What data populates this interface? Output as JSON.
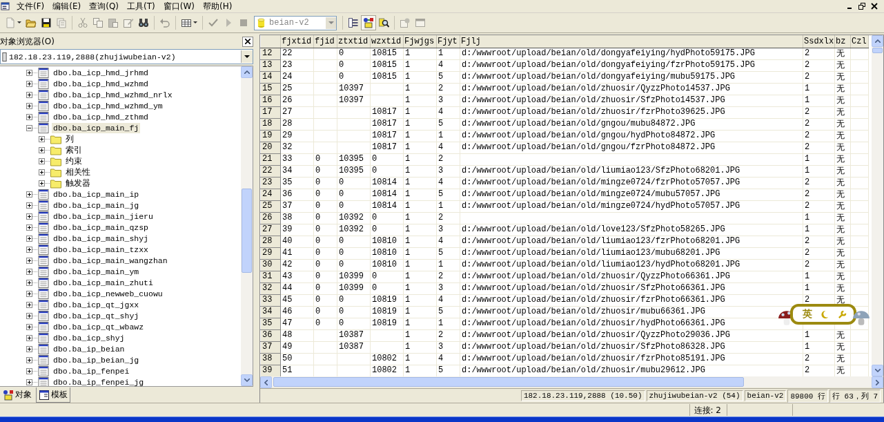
{
  "menu": [
    "文件(F)",
    "编辑(E)",
    "查询(Q)",
    "工具(T)",
    "窗口(W)",
    "帮助(H)"
  ],
  "toolbar_left": [
    [
      {
        "kind": "new",
        "disabled": true,
        "pressed": false
      },
      {
        "kind": "open",
        "disabled": false,
        "pressed": false
      },
      {
        "kind": "save",
        "disabled": false,
        "pressed": false
      },
      {
        "kind": "template",
        "disabled": true,
        "pressed": false
      }
    ],
    [
      {
        "kind": "cut",
        "disabled": true,
        "pressed": false
      },
      {
        "kind": "copy",
        "disabled": true,
        "pressed": false
      },
      {
        "kind": "paste",
        "disabled": true,
        "pressed": false
      },
      {
        "kind": "edit",
        "disabled": true,
        "pressed": false
      },
      {
        "kind": "find",
        "disabled": false,
        "pressed": false
      }
    ],
    [
      {
        "kind": "undo",
        "disabled": true,
        "pressed": false
      }
    ],
    [
      {
        "kind": "grid",
        "disabled": false,
        "pressed": false
      }
    ],
    [
      {
        "kind": "check",
        "disabled": true,
        "pressed": false
      },
      {
        "kind": "run",
        "disabled": true,
        "pressed": false
      },
      {
        "kind": "stop",
        "disabled": true,
        "pressed": false
      }
    ]
  ],
  "database_combo": {
    "value": "beian-v2"
  },
  "toolbar_right": [
    [
      {
        "kind": "pane",
        "disabled": false,
        "pressed": false
      },
      {
        "kind": "browser",
        "disabled": false,
        "pressed": true
      },
      {
        "kind": "search",
        "disabled": false,
        "pressed": false
      }
    ],
    [
      {
        "kind": "props",
        "disabled": true,
        "pressed": false
      },
      {
        "kind": "window",
        "disabled": true,
        "pressed": false
      }
    ]
  ],
  "object_browser": {
    "title": "对象浏览器(O)",
    "connection": "182.18.23.119,2888(zhujiwubeian-v2)",
    "tree": [
      {
        "label": "dbo.ba_icp_hmd_jrhmd",
        "kind": "table",
        "expanded": false,
        "selected": false
      },
      {
        "label": "dbo.ba_icp_hmd_wzhmd",
        "kind": "table",
        "expanded": false,
        "selected": false
      },
      {
        "label": "dbo.ba_icp_hmd_wzhmd_nrlx",
        "kind": "table",
        "expanded": false,
        "selected": false
      },
      {
        "label": "dbo.ba_icp_hmd_wzhmd_ym",
        "kind": "table",
        "expanded": false,
        "selected": false
      },
      {
        "label": "dbo.ba_icp_hmd_zthmd",
        "kind": "table",
        "expanded": false,
        "selected": false
      },
      {
        "label": "dbo.ba_icp_main_fj",
        "kind": "table",
        "expanded": true,
        "selected": true,
        "children": [
          {
            "label": "列",
            "kind": "folder",
            "expanded": false,
            "selected": false
          },
          {
            "label": "索引",
            "kind": "folder",
            "expanded": false,
            "selected": false
          },
          {
            "label": "约束",
            "kind": "folder",
            "expanded": false,
            "selected": false
          },
          {
            "label": "相关性",
            "kind": "folder",
            "expanded": false,
            "selected": false
          },
          {
            "label": "触发器",
            "kind": "folder",
            "expanded": false,
            "selected": false
          }
        ]
      },
      {
        "label": "dbo.ba_icp_main_ip",
        "kind": "table",
        "expanded": false,
        "selected": false
      },
      {
        "label": "dbo.ba_icp_main_jg",
        "kind": "table",
        "expanded": false,
        "selected": false
      },
      {
        "label": "dbo.ba_icp_main_jieru",
        "kind": "table",
        "expanded": false,
        "selected": false
      },
      {
        "label": "dbo.ba_icp_main_qzsp",
        "kind": "table",
        "expanded": false,
        "selected": false
      },
      {
        "label": "dbo.ba_icp_main_shyj",
        "kind": "table",
        "expanded": false,
        "selected": false
      },
      {
        "label": "dbo.ba_icp_main_tzxx",
        "kind": "table",
        "expanded": false,
        "selected": false
      },
      {
        "label": "dbo.ba_icp_main_wangzhan",
        "kind": "table",
        "expanded": false,
        "selected": false
      },
      {
        "label": "dbo.ba_icp_main_ym",
        "kind": "table",
        "expanded": false,
        "selected": false
      },
      {
        "label": "dbo.ba_icp_main_zhuti",
        "kind": "table",
        "expanded": false,
        "selected": false
      },
      {
        "label": "dbo.ba_icp_newweb_cuowu",
        "kind": "table",
        "expanded": false,
        "selected": false
      },
      {
        "label": "dbo.ba_icp_qt_jgxx",
        "kind": "table",
        "expanded": false,
        "selected": false
      },
      {
        "label": "dbo.ba_icp_qt_shyj",
        "kind": "table",
        "expanded": false,
        "selected": false
      },
      {
        "label": "dbo.ba_icp_qt_wbawz",
        "kind": "table",
        "expanded": false,
        "selected": false
      },
      {
        "label": "dbo.ba_icp_shyj",
        "kind": "table",
        "expanded": false,
        "selected": false
      },
      {
        "label": "dbo.ba_ip_beian",
        "kind": "table",
        "expanded": false,
        "selected": false
      },
      {
        "label": "dbo.ba_ip_beian_jg",
        "kind": "table",
        "expanded": false,
        "selected": false
      },
      {
        "label": "dbo.ba_ip_fenpei",
        "kind": "table",
        "expanded": false,
        "selected": false
      },
      {
        "label": "dbo.ba_ip_fenpei_jg",
        "kind": "table",
        "expanded": false,
        "selected": false
      }
    ],
    "tabs": [
      {
        "label": "对象",
        "selected": true
      },
      {
        "label": "模板",
        "selected": false
      }
    ]
  },
  "results": {
    "columns": [
      "fjxtid",
      "fjid",
      "ztxtid",
      "wzxtid",
      "Fjwjgs",
      "Fjyt",
      "Fjlj",
      "Ssdxlx",
      "bz",
      "Czl"
    ],
    "rows": [
      {
        "n": "12",
        "cells": [
          "22",
          null,
          "0",
          "10815",
          "1",
          "1",
          "d:/wwwroot/upload/beian/old/dongyafeiying/hydPhoto59175.JPG",
          "2",
          "无",
          null
        ]
      },
      {
        "n": "13",
        "cells": [
          "23",
          null,
          "0",
          "10815",
          "1",
          "4",
          "d:/wwwroot/upload/beian/old/dongyafeiying/fzrPhoto59175.JPG",
          "2",
          "无",
          null
        ]
      },
      {
        "n": "14",
        "cells": [
          "24",
          null,
          "0",
          "10815",
          "1",
          "5",
          "d:/wwwroot/upload/beian/old/dongyafeiying/mubu59175.JPG",
          "2",
          "无",
          null
        ]
      },
      {
        "n": "15",
        "cells": [
          "25",
          null,
          "10397",
          null,
          "1",
          "2",
          "d:/wwwroot/upload/beian/old/zhuosir/QyzzPhoto14537.JPG",
          "1",
          "无",
          null
        ]
      },
      {
        "n": "16",
        "cells": [
          "26",
          null,
          "10397",
          null,
          "1",
          "3",
          "d:/wwwroot/upload/beian/old/zhuosir/SfzPhoto14537.JPG",
          "1",
          "无",
          null
        ]
      },
      {
        "n": "17",
        "cells": [
          "27",
          null,
          null,
          "10817",
          "1",
          "4",
          "d:/wwwroot/upload/beian/old/zhuosir/fzrPhoto39625.JPG",
          "2",
          "无",
          null
        ]
      },
      {
        "n": "18",
        "cells": [
          "28",
          null,
          null,
          "10817",
          "1",
          "5",
          "d:/wwwroot/upload/beian/old/gngou/mubu84872.JPG",
          "2",
          "无",
          null
        ]
      },
      {
        "n": "19",
        "cells": [
          "29",
          null,
          null,
          "10817",
          "1",
          "1",
          "d:/wwwroot/upload/beian/old/gngou/hydPhoto84872.JPG",
          "2",
          "无",
          null
        ]
      },
      {
        "n": "20",
        "cells": [
          "32",
          null,
          null,
          "10817",
          "1",
          "4",
          "d:/wwwroot/upload/beian/old/gngou/fzrPhoto84872.JPG",
          "2",
          "无",
          null
        ]
      },
      {
        "n": "21",
        "cells": [
          "33",
          "0",
          "10395",
          "0",
          "1",
          "2",
          null,
          "1",
          "无",
          null
        ]
      },
      {
        "n": "22",
        "cells": [
          "34",
          "0",
          "10395",
          "0",
          "1",
          "3",
          "d:/wwwroot/upload/beian/old/liumiao123/SfzPhoto68201.JPG",
          "1",
          "无",
          null
        ]
      },
      {
        "n": "23",
        "cells": [
          "35",
          "0",
          "0",
          "10814",
          "1",
          "4",
          "d:/wwwroot/upload/beian/old/mingze0724/fzrPhoto57057.JPG",
          "2",
          "无",
          null
        ]
      },
      {
        "n": "24",
        "cells": [
          "36",
          "0",
          "0",
          "10814",
          "1",
          "5",
          "d:/wwwroot/upload/beian/old/mingze0724/mubu57057.JPG",
          "2",
          "无",
          null
        ]
      },
      {
        "n": "25",
        "cells": [
          "37",
          "0",
          "0",
          "10814",
          "1",
          "1",
          "d:/wwwroot/upload/beian/old/mingze0724/hydPhoto57057.JPG",
          "2",
          "无",
          null
        ]
      },
      {
        "n": "26",
        "cells": [
          "38",
          "0",
          "10392",
          "0",
          "1",
          "2",
          null,
          "1",
          "无",
          null
        ]
      },
      {
        "n": "27",
        "cells": [
          "39",
          "0",
          "10392",
          "0",
          "1",
          "3",
          "d:/wwwroot/upload/beian/old/love123/SfzPhoto58265.JPG",
          "1",
          "无",
          null
        ]
      },
      {
        "n": "28",
        "cells": [
          "40",
          "0",
          "0",
          "10810",
          "1",
          "4",
          "d:/wwwroot/upload/beian/old/liumiao123/fzrPhoto68201.JPG",
          "2",
          "无",
          null
        ]
      },
      {
        "n": "29",
        "cells": [
          "41",
          "0",
          "0",
          "10810",
          "1",
          "5",
          "d:/wwwroot/upload/beian/old/liumiao123/mubu68201.JPG",
          "2",
          "无",
          null
        ]
      },
      {
        "n": "30",
        "cells": [
          "42",
          "0",
          "0",
          "10810",
          "1",
          "1",
          "d:/wwwroot/upload/beian/old/liumiao123/hydPhoto68201.JPG",
          "2",
          "无",
          null
        ]
      },
      {
        "n": "31",
        "cells": [
          "43",
          "0",
          "10399",
          "0",
          "1",
          "2",
          "d:/wwwroot/upload/beian/old/zhuosir/QyzzPhoto66361.JPG",
          "1",
          "无",
          null
        ]
      },
      {
        "n": "32",
        "cells": [
          "44",
          "0",
          "10399",
          "0",
          "1",
          "3",
          "d:/wwwroot/upload/beian/old/zhuosir/SfzPhoto66361.JPG",
          "1",
          "无",
          null
        ]
      },
      {
        "n": "33",
        "cells": [
          "45",
          "0",
          "0",
          "10819",
          "1",
          "4",
          "d:/wwwroot/upload/beian/old/zhuosir/fzrPhoto66361.JPG",
          "2",
          "无",
          null
        ]
      },
      {
        "n": "34",
        "cells": [
          "46",
          "0",
          "0",
          "10819",
          "1",
          "5",
          "d:/wwwroot/upload/beian/old/zhuosir/mubu66361.JPG",
          null,
          null,
          null
        ]
      },
      {
        "n": "35",
        "cells": [
          "47",
          "0",
          "0",
          "10819",
          "1",
          "1",
          "d:/wwwroot/upload/beian/old/zhuosir/hydPhoto66361.JPG",
          null,
          null,
          null
        ]
      },
      {
        "n": "36",
        "cells": [
          "48",
          null,
          "10387",
          null,
          "1",
          "2",
          "d:/wwwroot/upload/beian/old/zhuosir/QyzzPhoto29036.JPG",
          "1",
          "无",
          null
        ]
      },
      {
        "n": "37",
        "cells": [
          "49",
          null,
          "10387",
          null,
          "1",
          "3",
          "d:/wwwroot/upload/beian/old/zhuosir/SfzPhoto86328.JPG",
          "1",
          "无",
          null
        ]
      },
      {
        "n": "38",
        "cells": [
          "50",
          null,
          null,
          "10802",
          "1",
          "4",
          "d:/wwwroot/upload/beian/old/zhuosir/fzrPhoto85191.JPG",
          "2",
          "无",
          null
        ]
      },
      {
        "n": "39",
        "cells": [
          "51",
          null,
          null,
          "10802",
          "1",
          "5",
          "d:/wwwroot/upload/beian/old/zhuosir/mubu29612.JPG",
          "2",
          "无",
          null
        ]
      }
    ]
  },
  "ime": {
    "mode": "英"
  },
  "status_bar": [
    "182.18.23.119,2888 (10.50)",
    "zhujiwubeian-v2 (54)",
    "beian-v2",
    "89800 行",
    "行 63，列 7"
  ],
  "connections": "连接: 2"
}
